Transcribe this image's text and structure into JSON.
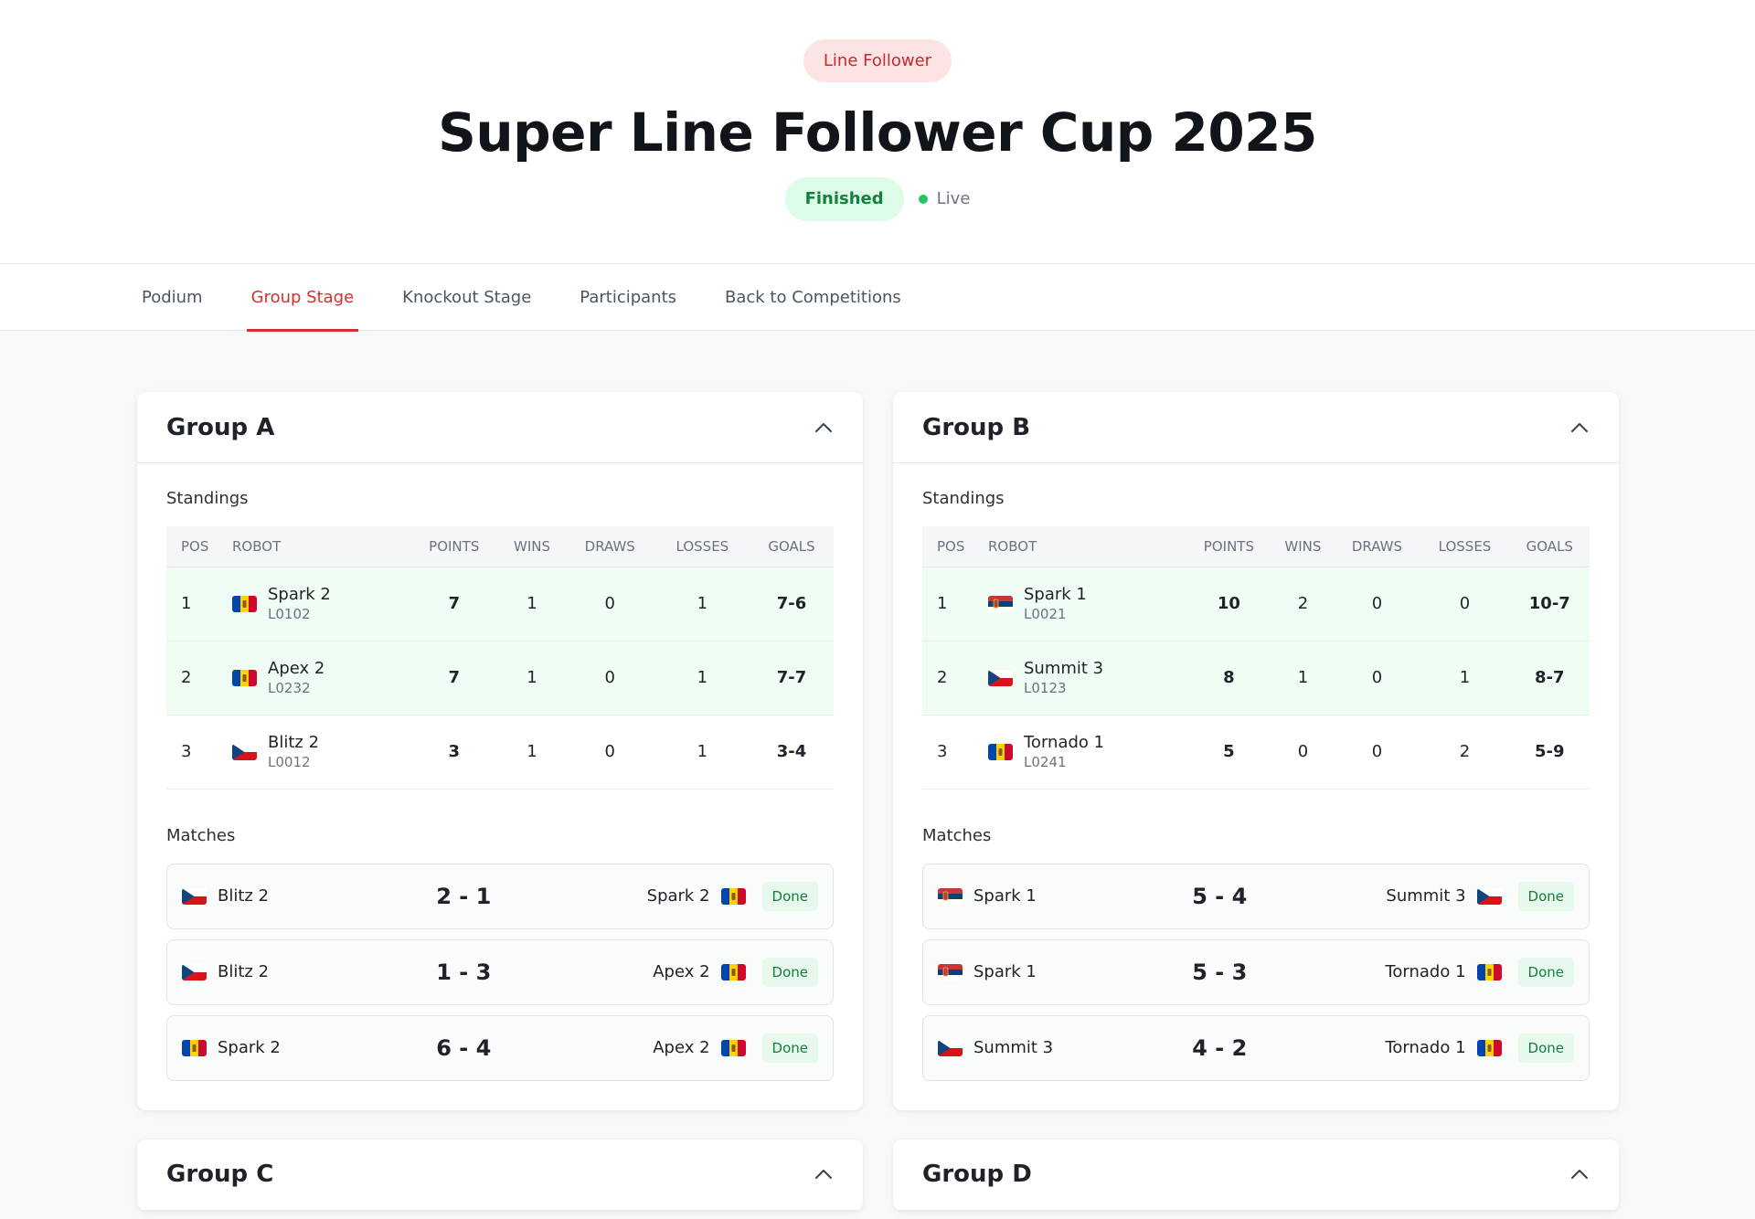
{
  "header": {
    "category": "Line Follower",
    "title": "Super Line Follower Cup 2025",
    "status": "Finished",
    "live": "Live"
  },
  "tabs": [
    {
      "label": "Podium",
      "active": false
    },
    {
      "label": "Group Stage",
      "active": true
    },
    {
      "label": "Knockout Stage",
      "active": false
    },
    {
      "label": "Participants",
      "active": false
    },
    {
      "label": "Back to Competitions",
      "active": false
    }
  ],
  "labels": {
    "standings": "Standings",
    "matches": "Matches",
    "done": "Done",
    "columns": {
      "pos": "POS",
      "robot": "ROBOT",
      "points": "POINTS",
      "wins": "WINS",
      "draws": "DRAWS",
      "losses": "LOSSES",
      "goals": "GOALS"
    }
  },
  "colors": {
    "accent": "#d32f2f",
    "qualified_row": "#f0fdf4",
    "done_badge": "#e7f8ec"
  },
  "groups": [
    {
      "name": "Group A",
      "standings": [
        {
          "pos": "1",
          "flag": "md-flag",
          "name": "Spark 2",
          "code": "L0102",
          "points": "7",
          "wins": "1",
          "draws": "0",
          "losses": "1",
          "goals": "7-6"
        },
        {
          "pos": "2",
          "flag": "md-flag",
          "name": "Apex 2",
          "code": "L0232",
          "points": "7",
          "wins": "1",
          "draws": "0",
          "losses": "1",
          "goals": "7-7"
        },
        {
          "pos": "3",
          "flag": "cz-flag",
          "name": "Blitz 2",
          "code": "L0012",
          "points": "3",
          "wins": "1",
          "draws": "0",
          "losses": "1",
          "goals": "3-4"
        }
      ],
      "matches": [
        {
          "home": "Blitz 2",
          "home_flag": "cz-flag",
          "score": "2 - 1",
          "away": "Spark 2",
          "away_flag": "md-flag"
        },
        {
          "home": "Blitz 2",
          "home_flag": "cz-flag",
          "score": "1 - 3",
          "away": "Apex 2",
          "away_flag": "md-flag"
        },
        {
          "home": "Spark 2",
          "home_flag": "md-flag",
          "score": "6 - 4",
          "away": "Apex 2",
          "away_flag": "md-flag"
        }
      ]
    },
    {
      "name": "Group B",
      "standings": [
        {
          "pos": "1",
          "flag": "rs-flag",
          "name": "Spark 1",
          "code": "L0021",
          "points": "10",
          "wins": "2",
          "draws": "0",
          "losses": "0",
          "goals": "10-7"
        },
        {
          "pos": "2",
          "flag": "cz-flag",
          "name": "Summit 3",
          "code": "L0123",
          "points": "8",
          "wins": "1",
          "draws": "0",
          "losses": "1",
          "goals": "8-7"
        },
        {
          "pos": "3",
          "flag": "md-flag",
          "name": "Tornado 1",
          "code": "L0241",
          "points": "5",
          "wins": "0",
          "draws": "0",
          "losses": "2",
          "goals": "5-9"
        }
      ],
      "matches": [
        {
          "home": "Spark 1",
          "home_flag": "rs-flag",
          "score": "5 - 4",
          "away": "Summit 3",
          "away_flag": "cz-flag"
        },
        {
          "home": "Spark 1",
          "home_flag": "rs-flag",
          "score": "5 - 3",
          "away": "Tornado 1",
          "away_flag": "md-flag"
        },
        {
          "home": "Summit 3",
          "home_flag": "cz-flag",
          "score": "4 - 2",
          "away": "Tornado 1",
          "away_flag": "md-flag"
        }
      ]
    },
    {
      "name": "Group C"
    },
    {
      "name": "Group D"
    }
  ]
}
